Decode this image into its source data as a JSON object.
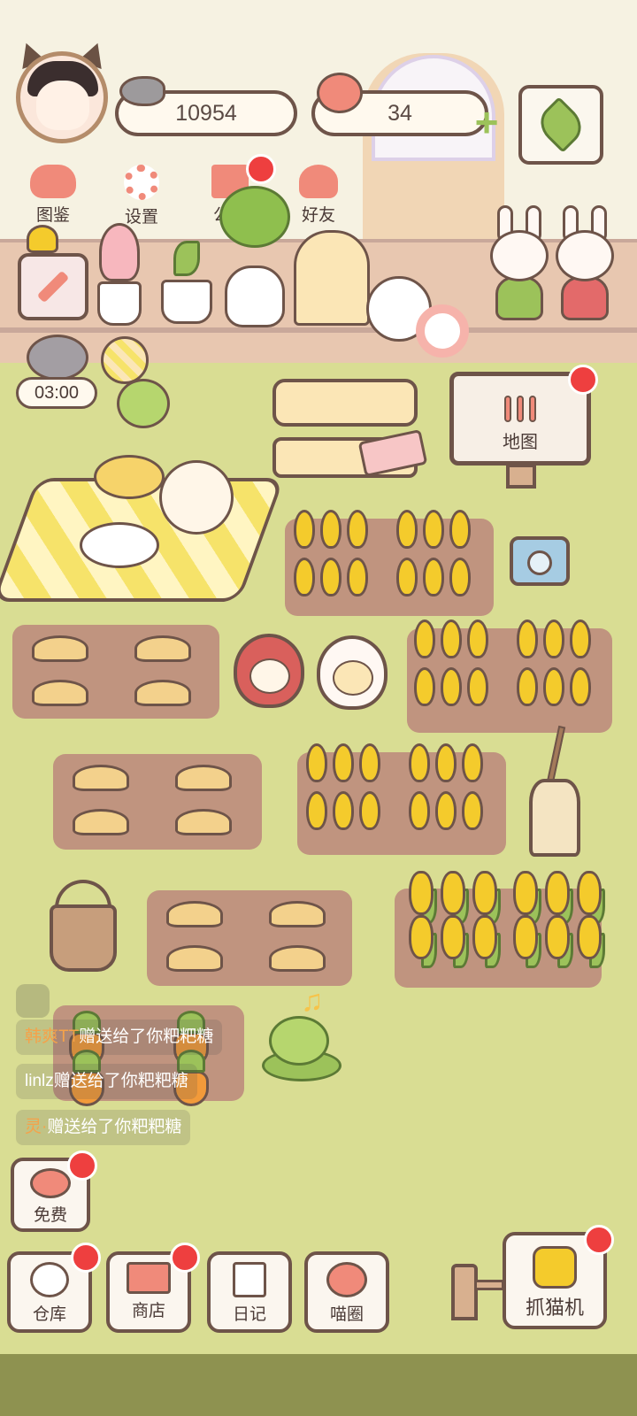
{
  "currency": {
    "fish": "10954",
    "hearts": "34"
  },
  "top_menu": [
    {
      "label": "图鉴",
      "icon": "cat-face-icon",
      "badge": false
    },
    {
      "label": "设置",
      "icon": "gear-icon",
      "badge": false
    },
    {
      "label": "公告",
      "icon": "gift-icon",
      "badge": true
    },
    {
      "label": "好友",
      "icon": "friends-icon",
      "badge": false
    }
  ],
  "timer": "03:00",
  "map_sign": "地图",
  "chat": [
    {
      "sender": "韩爽TT",
      "text": "赠送给了你粑粑糖"
    },
    {
      "sender": "linlz",
      "text": "赠送给了你粑粑糖"
    },
    {
      "sender": "灵·",
      "text": "赠送给了你粑粑糖"
    }
  ],
  "free_button": "免费",
  "bottom_bar": [
    {
      "label": "仓库",
      "icon": "warehouse-icon",
      "badge": true
    },
    {
      "label": "商店",
      "icon": "shop-icon",
      "badge": true
    },
    {
      "label": "日记",
      "icon": "diary-icon",
      "badge": false
    },
    {
      "label": "喵圈",
      "icon": "cat-planet-icon",
      "badge": false
    }
  ],
  "claw_machine": "抓猫机",
  "colors": {
    "badge": "#ee3f3f",
    "accent_pink": "#f08a7a",
    "grass": "#d9dd93",
    "soil": "#c0947f",
    "outline": "#6e5449"
  }
}
